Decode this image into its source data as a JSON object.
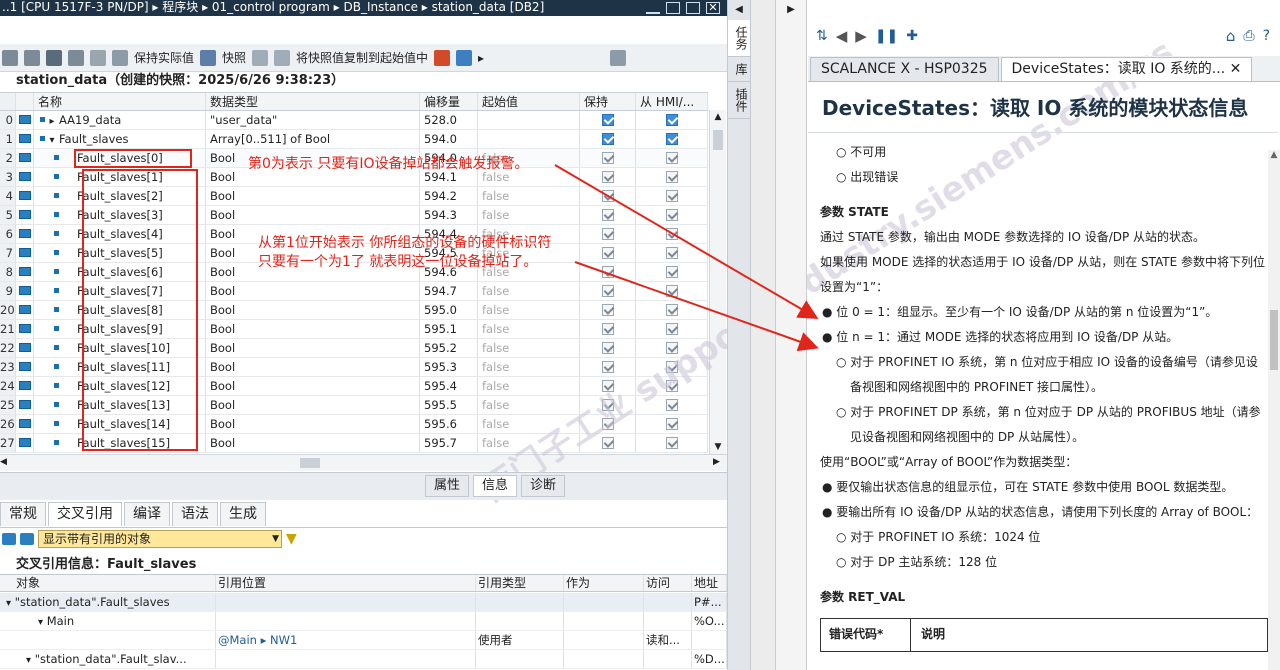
{
  "path": "..1 [CPU 1517F-3 PN/DP] ▸ 程序块 ▸ 01_control program ▸ DB_Instance ▸ station_data [DB2]",
  "toolbar": {
    "keep_actual": "保持实际值",
    "snapshot": "快照",
    "copy_snapshot": "将快照值复制到起始值中"
  },
  "db_title": "station_data（创建的快照：2025/6/26 9:38:23）",
  "columns": {
    "name": "名称",
    "datatype": "数据类型",
    "offset": "偏移量",
    "start": "起始值",
    "retain": "保持",
    "hmi": "从 HMI/..."
  },
  "rows": [
    {
      "num": "0",
      "name": "AA19_data",
      "type": "\"user_data\"",
      "offset": "528.0",
      "start": "",
      "retain": true,
      "hmi": true
    },
    {
      "num": "1",
      "name": "Fault_slaves",
      "type": "Array[0..511] of Bool",
      "offset": "594.0",
      "start": "",
      "retain": true,
      "hmi": true
    },
    {
      "num": "2",
      "name": "Fault_slaves[0]",
      "type": "Bool",
      "offset": "594.0",
      "start": "false",
      "retain": true,
      "hmi": true
    },
    {
      "num": "3",
      "name": "Fault_slaves[1]",
      "type": "Bool",
      "offset": "594.1",
      "start": "false",
      "retain": true,
      "hmi": true
    },
    {
      "num": "4",
      "name": "Fault_slaves[2]",
      "type": "Bool",
      "offset": "594.2",
      "start": "false",
      "retain": true,
      "hmi": true
    },
    {
      "num": "5",
      "name": "Fault_slaves[3]",
      "type": "Bool",
      "offset": "594.3",
      "start": "false",
      "retain": true,
      "hmi": true
    },
    {
      "num": "6",
      "name": "Fault_slaves[4]",
      "type": "Bool",
      "offset": "594.4",
      "start": "false",
      "retain": true,
      "hmi": true
    },
    {
      "num": "7",
      "name": "Fault_slaves[5]",
      "type": "Bool",
      "offset": "594.5",
      "start": "false",
      "retain": true,
      "hmi": true
    },
    {
      "num": "8",
      "name": "Fault_slaves[6]",
      "type": "Bool",
      "offset": "594.6",
      "start": "false",
      "retain": true,
      "hmi": true
    },
    {
      "num": "9",
      "name": "Fault_slaves[7]",
      "type": "Bool",
      "offset": "594.7",
      "start": "false",
      "retain": true,
      "hmi": true
    },
    {
      "num": "20",
      "name": "Fault_slaves[8]",
      "type": "Bool",
      "offset": "595.0",
      "start": "false",
      "retain": true,
      "hmi": true
    },
    {
      "num": "21",
      "name": "Fault_slaves[9]",
      "type": "Bool",
      "offset": "595.1",
      "start": "false",
      "retain": true,
      "hmi": true
    },
    {
      "num": "22",
      "name": "Fault_slaves[10]",
      "type": "Bool",
      "offset": "595.2",
      "start": "false",
      "retain": true,
      "hmi": true
    },
    {
      "num": "23",
      "name": "Fault_slaves[11]",
      "type": "Bool",
      "offset": "595.3",
      "start": "false",
      "retain": true,
      "hmi": true
    },
    {
      "num": "24",
      "name": "Fault_slaves[12]",
      "type": "Bool",
      "offset": "595.4",
      "start": "false",
      "retain": true,
      "hmi": true
    },
    {
      "num": "25",
      "name": "Fault_slaves[13]",
      "type": "Bool",
      "offset": "595.5",
      "start": "false",
      "retain": true,
      "hmi": true
    },
    {
      "num": "26",
      "name": "Fault_slaves[14]",
      "type": "Bool",
      "offset": "595.6",
      "start": "false",
      "retain": true,
      "hmi": true
    },
    {
      "num": "27",
      "name": "Fault_slaves[15]",
      "type": "Bool",
      "offset": "595.7",
      "start": "false",
      "retain": true,
      "hmi": true
    }
  ],
  "annotations": {
    "a1": "第0为表示  只要有IO设备掉站都会触发报警。",
    "a2_line1": "从第1位开始表示 你所组态的设备的硬件标识符",
    "a2_line2": "只要有一个为1了 就表明这一位设备掉站了。"
  },
  "watermark": "西门子工业 support.industry.siemens.com/cs",
  "side_tabs": [
    "任务",
    "库",
    "插件"
  ],
  "bottom_tabs": [
    "属性",
    "信息",
    "诊断"
  ],
  "panel_tabs": [
    "常规",
    "交叉引用",
    "编译",
    "语法",
    "生成"
  ],
  "filter": "显示带有引用的对象",
  "xref_title": "交叉引用信息：Fault_slaves",
  "xref_columns": [
    "对象",
    "引用位置",
    "引用类型",
    "作为",
    "访问",
    "地址"
  ],
  "xref_rows": [
    {
      "obj": "\"station_data\".Fault_slaves",
      "loc": "",
      "type": "",
      "as": "",
      "access": "",
      "addr": "P#..."
    },
    {
      "obj": "Main",
      "loc": "",
      "type": "",
      "as": "",
      "access": "",
      "addr": "%O..."
    },
    {
      "obj": "",
      "loc": "@Main ▸ NW1",
      "type": "使用者",
      "as": "",
      "access": "读和...",
      "addr": ""
    },
    {
      "obj": "\"station_data\".Fault_slav...",
      "loc": "",
      "type": "",
      "as": "",
      "access": "",
      "addr": "%D..."
    }
  ],
  "help": {
    "tab1": "SCALANCE X - HSP0325",
    "tab2": "DeviceStates：读取 IO 系统的...",
    "title": "DeviceStates：读取 IO 系统的模块状态信息",
    "items": [
      {
        "kind": "sub",
        "text": "不可用"
      },
      {
        "kind": "sub",
        "text": "出现错误"
      },
      {
        "kind": "heading",
        "text": "参数 STATE"
      },
      {
        "kind": "para",
        "text": "通过 STATE 参数，输出由 MODE 参数选择的 IO 设备/DP 从站的状态。"
      },
      {
        "kind": "para",
        "text": "如果使用 MODE 选择的状态适用于 IO 设备/DP 从站，则在 STATE 参数中将下列位设置为“1”："
      },
      {
        "kind": "bullet",
        "text": "位 0 = 1：组显示。至少有一个 IO 设备/DP 从站的第 n 位设置为“1”。"
      },
      {
        "kind": "bullet",
        "text": "位 n = 1：通过 MODE 选择的状态将应用到 IO 设备/DP 从站。"
      },
      {
        "kind": "sub",
        "text": "对于 PROFINET IO 系统，第 n 位对应于相应 IO 设备的设备编号（请参见设备视图和网络视图中的 PROFINET 接口属性）。"
      },
      {
        "kind": "sub",
        "text": "对于 PROFINET DP 系统，第 n 位对应于 DP 从站的 PROFIBUS 地址（请参见设备视图和网络视图中的 DP 从站属性）。"
      },
      {
        "kind": "para",
        "text": "使用“BOOL”或“Array of BOOL”作为数据类型："
      },
      {
        "kind": "bullet",
        "text": "要仅输出状态信息的组显示位，可在 STATE 参数中使用 BOOL 数据类型。"
      },
      {
        "kind": "bullet",
        "text": "要输出所有 IO 设备/DP 从站的状态信息，请使用下列长度的 Array of BOOL："
      },
      {
        "kind": "sub",
        "text": "对于 PROFINET IO 系统：1024 位"
      },
      {
        "kind": "sub",
        "text": "对于 DP 主站系统：128 位"
      },
      {
        "kind": "heading",
        "text": "参数 RET_VAL"
      }
    ],
    "table_headers": [
      "错误代码*",
      "说明"
    ]
  }
}
